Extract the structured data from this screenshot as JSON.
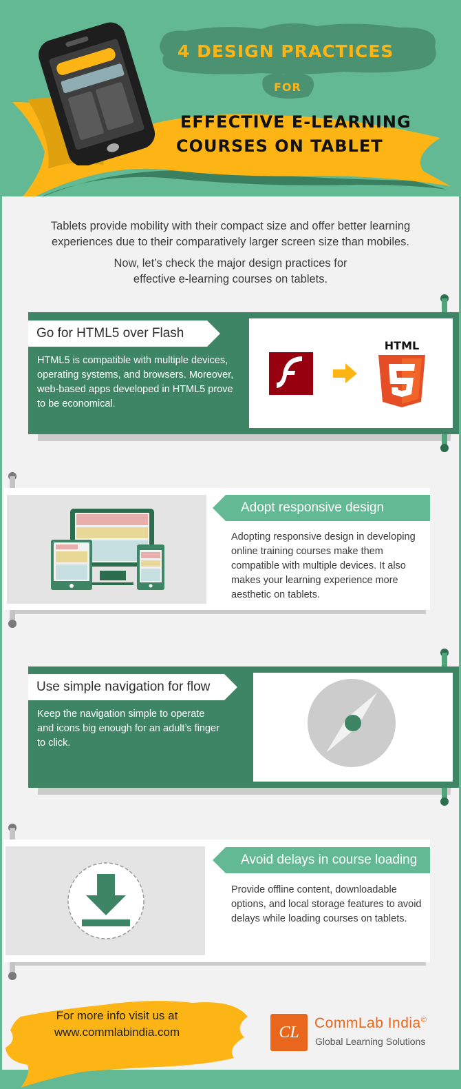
{
  "header": {
    "title_line1": "4 DESIGN PRACTICES",
    "title_line2": "FOR",
    "title_line3": "EFFECTIVE E-LEARNING",
    "title_line4": "COURSES ON TABLET",
    "illustration": "tablet-icon",
    "colors": {
      "background": "#62b994",
      "ribbon": "#fdb515",
      "accent_dark": "#3e8565"
    }
  },
  "intro": {
    "paragraph1_line1": "Tablets provide mobility with their compact size and offer better learning",
    "paragraph1_line2": "experiences due to their comparatively larger screen size than mobiles.",
    "paragraph2_line1": "Now, let’s check the major design practices for",
    "paragraph2_line2": "effective e-learning courses on tablets."
  },
  "practices": [
    {
      "title": "Go for HTML5 over Flash",
      "body": "HTML5 is compatible with multiple devices, operating systems, and browsers. Moreover, web-based apps developed in HTML5 prove to be economical.",
      "icons": [
        "flash-icon",
        "arrow-right-icon",
        "html5-icon"
      ],
      "html5_label": "HTML",
      "html5_number": "5"
    },
    {
      "title": "Adopt responsive design",
      "body": "Adopting responsive design in developing online training courses make them compatible with multiple devices. It also makes your learning experience more aesthetic on tablets.",
      "icons": [
        "responsive-devices-icon"
      ]
    },
    {
      "title": "Use simple navigation for flow",
      "body": "Keep the navigation simple to operate and icons big enough for an adult’s finger to click.",
      "icons": [
        "compass-icon"
      ]
    },
    {
      "title": "Avoid delays in course loading",
      "body": "Provide offline content, downloadable options, and local storage features to avoid delays while loading courses on tablets.",
      "icons": [
        "download-icon"
      ]
    }
  ],
  "footer": {
    "cta_line1": "For more info visit us at",
    "cta_line2": "www.commlabindia.com",
    "brand_mark": "CL",
    "brand_name": "CommLab India",
    "brand_copyright": "©",
    "brand_tagline": "Global Learning Solutions"
  }
}
